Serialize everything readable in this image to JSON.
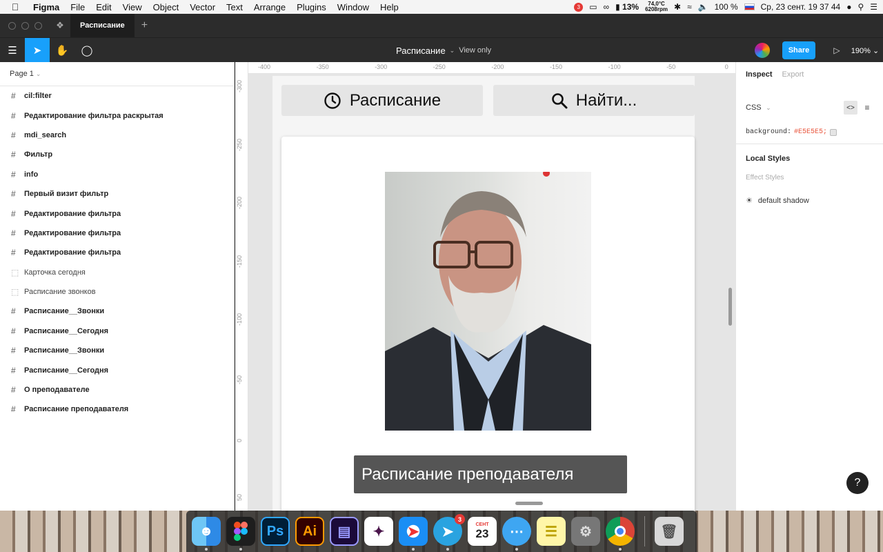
{
  "menubar": {
    "app": "Figma",
    "items": [
      "File",
      "Edit",
      "View",
      "Object",
      "Vector",
      "Text",
      "Arrange",
      "Plugins",
      "Window",
      "Help"
    ],
    "notification_count": "3",
    "battery": "13%",
    "temperature": "74,0°C",
    "fan": "6208rpm",
    "volume_pct": "100 %",
    "datetime": "Ср, 23 сент.  19 37 44"
  },
  "titlebar": {
    "tab_label": "Расписание"
  },
  "toolbar": {
    "doc_title": "Расписание",
    "view_mode": "View only",
    "share_label": "Share",
    "zoom": "190%"
  },
  "leftpanel": {
    "page": "Page 1",
    "layers": [
      {
        "label": "cil:filter",
        "kind": "frame"
      },
      {
        "label": "Редактирование фильтра раскрытая",
        "kind": "frame"
      },
      {
        "label": "mdi_search",
        "kind": "frame"
      },
      {
        "label": "Фильтр",
        "kind": "frame"
      },
      {
        "label": "info",
        "kind": "frame"
      },
      {
        "label": "Первый визит фильтр",
        "kind": "frame"
      },
      {
        "label": "Редактирование фильтра",
        "kind": "frame"
      },
      {
        "label": "Редактирование фильтра",
        "kind": "frame"
      },
      {
        "label": "Редактирование фильтра",
        "kind": "frame"
      },
      {
        "label": "Карточка сегодня",
        "kind": "component"
      },
      {
        "label": "Расписание звонков",
        "kind": "component"
      },
      {
        "label": "Расписание__Звонки",
        "kind": "frame"
      },
      {
        "label": "Расписание__Сегодня",
        "kind": "frame"
      },
      {
        "label": "Расписание__Звонки",
        "kind": "frame"
      },
      {
        "label": "Расписание__Сегодня",
        "kind": "frame"
      },
      {
        "label": "О преподавателе",
        "kind": "frame"
      },
      {
        "label": "Расписание преподавателя",
        "kind": "frame"
      }
    ]
  },
  "canvas": {
    "ruler_top": [
      "-400",
      "-350",
      "-300",
      "-250",
      "-200",
      "-150",
      "-100",
      "-50",
      "0"
    ],
    "ruler_left": [
      "-300",
      "-250",
      "-200",
      "-150",
      "-100",
      "-50",
      "0",
      "50"
    ],
    "schedule_button": "Расписание",
    "search_button": "Найти...",
    "caption": "Расписание преподавателя"
  },
  "rightpanel": {
    "tab_inspect": "Inspect",
    "tab_export": "Export",
    "code_lang": "CSS",
    "css_property": "background:",
    "css_value": "#E5E5E5;",
    "local_styles": "Local Styles",
    "effect_styles": "Effect Styles",
    "style_name": "default shadow",
    "help": "?"
  },
  "dock": {
    "apps": [
      "finder-icon",
      "figma-icon",
      "photoshop-icon",
      "illustrator-icon",
      "premiere-icon",
      "slack-icon",
      "safari-icon",
      "telegram-icon",
      "calendar-icon",
      "messages-icon",
      "notes-icon",
      "system-preferences-icon",
      "chrome-icon",
      "trash-icon"
    ],
    "ps_label": "Ps",
    "ai_label": "Ai",
    "telegram_badge": "3",
    "calendar_month": "СЕНТ",
    "calendar_day": "23"
  },
  "colors": {
    "accent": "#18A0FB",
    "canvas": "#E5E5E5",
    "css_value": "#E8533A"
  }
}
